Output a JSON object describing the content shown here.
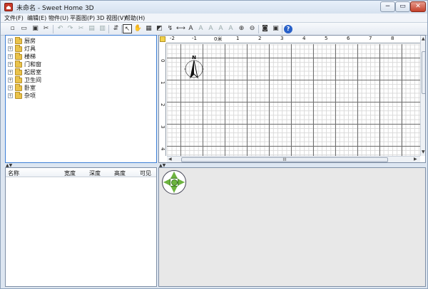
{
  "window": {
    "title": "未命名 - Sweet Home 3D",
    "min_label": "−",
    "max_label": "▭",
    "close_label": "✕"
  },
  "menu": [
    "文件(F)",
    "编辑(E)",
    "物件(U)",
    "平面图(P)",
    "3D 视图(V)",
    "帮助(H)"
  ],
  "toolbar": {
    "icons": [
      "new-icon",
      "open-icon",
      "save-icon",
      "cut-icon",
      "undo-icon",
      "redo-icon",
      "cut-icon",
      "copy-icon",
      "paste-icon",
      "add-furniture-icon",
      "select-icon",
      "pan-icon",
      "create-walls-icon",
      "create-rooms-icon",
      "create-polylines-icon",
      "create-dimensions-icon",
      "create-labels-icon",
      "text-style-icon",
      "increase-text-icon",
      "decrease-text-icon",
      "zoom-in-icon",
      "zoom-out-icon",
      "create-photo-icon",
      "create-video-icon",
      "help-icon"
    ],
    "help_label": "?"
  },
  "catalog": [
    {
      "label": "厨房"
    },
    {
      "label": "灯具"
    },
    {
      "label": "楼梯"
    },
    {
      "label": "门和窗"
    },
    {
      "label": "起居室"
    },
    {
      "label": "卫生间"
    },
    {
      "label": "卧室"
    },
    {
      "label": "杂项"
    }
  ],
  "furniture_table": {
    "columns": [
      "名称",
      "宽度",
      "深度",
      "高度",
      "可见"
    ]
  },
  "plan": {
    "ruler_top": [
      "-2",
      "-1",
      "0米",
      "1",
      "2",
      "3",
      "4",
      "5",
      "6",
      "7",
      "8"
    ],
    "ruler_left": [
      "0米",
      "1",
      "2",
      "3",
      "4"
    ],
    "compass_label": "N",
    "scroll_grip": "III"
  },
  "colors": {
    "accent": "#3d7fd6",
    "navigator": "#6db33f",
    "folder": "#e9c24a"
  }
}
